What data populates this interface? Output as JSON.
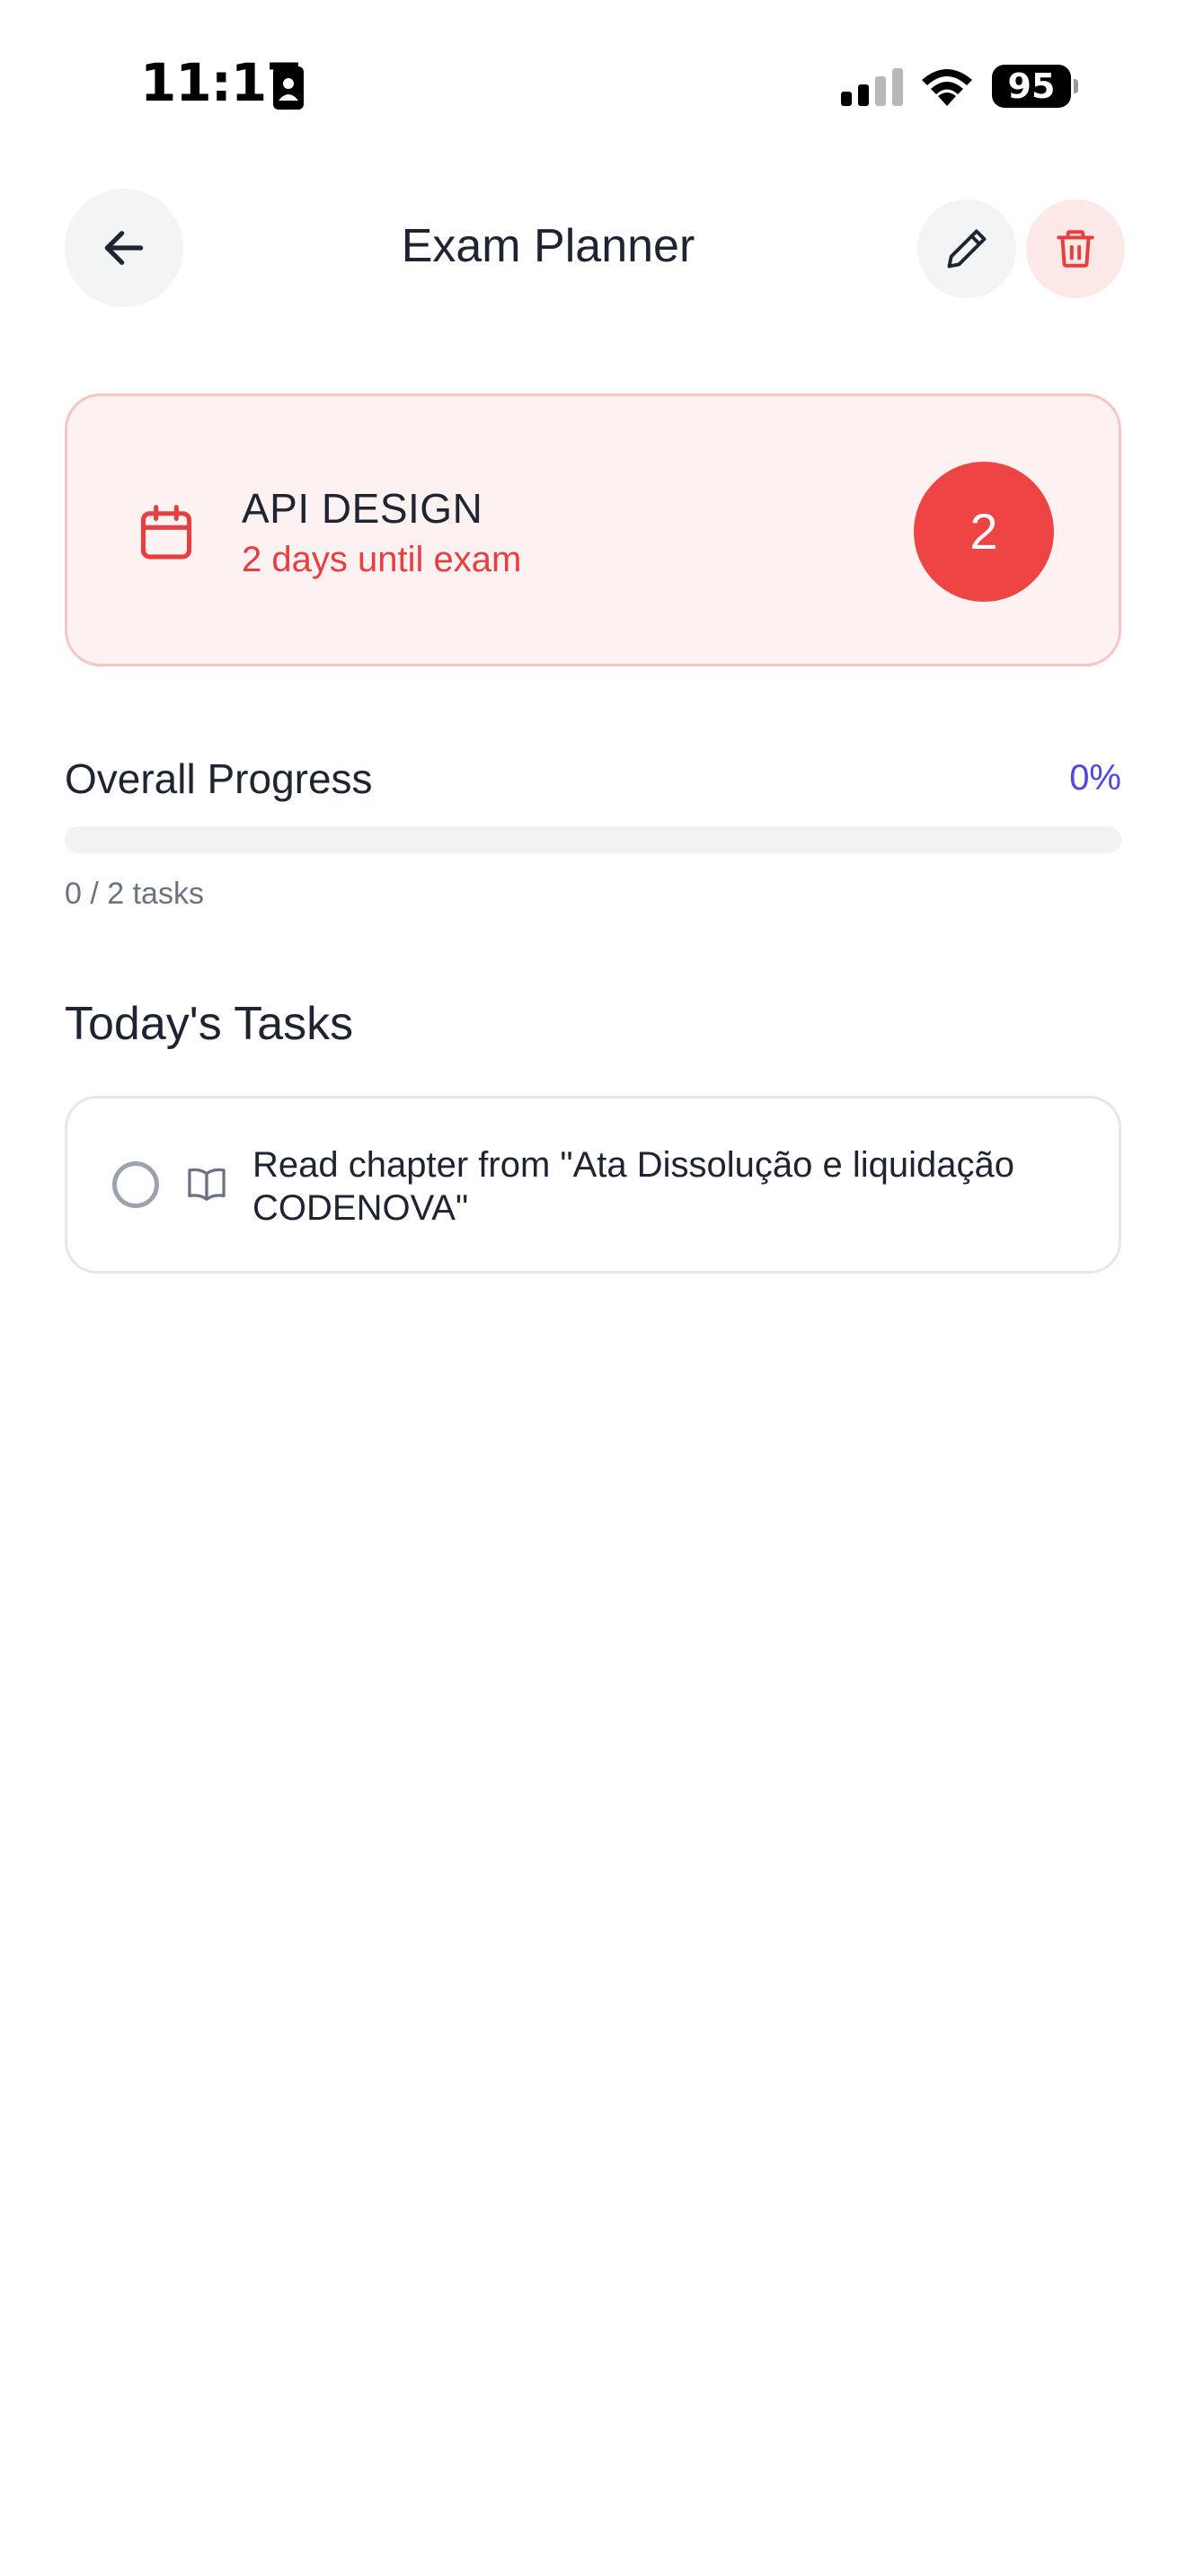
{
  "status_bar": {
    "time": "11:17",
    "battery": "95"
  },
  "header": {
    "title": "Exam Planner",
    "icons": {
      "back": "arrow-left-icon",
      "edit": "pencil-icon",
      "delete": "trash-icon"
    }
  },
  "exam": {
    "name": "API DESIGN",
    "countdown": "2 days until exam",
    "days_left": "2",
    "icon": "calendar-icon"
  },
  "progress": {
    "label": "Overall Progress",
    "percent_text": "0%",
    "fraction": 0,
    "tasks_text": "0 / 2 tasks"
  },
  "tasks": {
    "title": "Today's Tasks",
    "items": [
      {
        "text": "Read chapter from \"Ata Dissolução e liquidação CODENOVA\"",
        "done": false,
        "icon": "book-open-icon"
      }
    ]
  },
  "colors": {
    "accent": "#4f46e5",
    "danger": "#ef4444",
    "danger_text": "#e5403f",
    "card_bg": "#fdf1f1",
    "card_border": "#f8c4c4",
    "text": "#1f2433",
    "muted": "#6b7280"
  }
}
